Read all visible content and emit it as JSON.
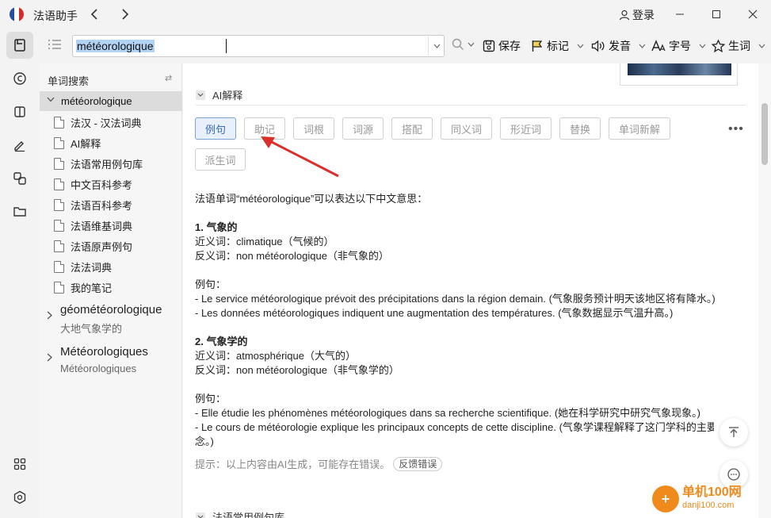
{
  "app": {
    "title": "法语助手",
    "login_label": "登录"
  },
  "search": {
    "value": "météorologique"
  },
  "toolbar": {
    "save": "保存",
    "mark": "标记",
    "pronounce": "发音",
    "font": "字号",
    "vocab": "生词"
  },
  "sidebar": {
    "header": "单词搜索",
    "selected": "météorologique",
    "items": [
      {
        "label": "法汉 - 汉法词典"
      },
      {
        "label": "AI解释"
      },
      {
        "label": "法语常用例句库"
      },
      {
        "label": "中文百科参考"
      },
      {
        "label": "法语百科参考"
      },
      {
        "label": "法语维基词典"
      },
      {
        "label": "法语原声例句"
      },
      {
        "label": "法法词典"
      },
      {
        "label": "我的笔记"
      }
    ],
    "entries": [
      {
        "word": "géométéorologique",
        "meaning": "大地气象学的"
      },
      {
        "word": "Météorologiques",
        "meaning": "Météorologiques"
      }
    ]
  },
  "main": {
    "section_title": "AI解释",
    "tags": [
      "例句",
      "助记",
      "词根",
      "词源",
      "搭配",
      "同义词",
      "形近词",
      "替换",
      "单词新解",
      "派生词"
    ],
    "intro": "法语单词“météorologique”可以表达以下中文意思：",
    "m1_title": "1. 气象的",
    "m1_syn": "近义词：climatique（气候的）",
    "m1_ant": "反义词：non météorologique（非气象的）",
    "ex_label_1": "例句：",
    "m1_ex1": "- Le service météorologique prévoit des précipitations dans la région demain. (气象服务预计明天该地区将有降水。)",
    "m1_ex2": "- Les données météorologiques indiquent une augmentation des températures. (气象数据显示气温升高。)",
    "m2_title": "2. 气象学的",
    "m2_syn": "近义词：atmosphérique（大气的）",
    "m2_ant": "反义词：non météorologique（非气象学的）",
    "ex_label_2": "例句：",
    "m2_ex1": "- Elle étudie les phénomènes météorologiques dans sa recherche scientifique. (她在科学研究中研究气象现象。)",
    "m2_ex2": "- Le cours de météorologie explique les principaux concepts de cette discipline. (气象学课程解释了这门学科的主要概",
    "m2_ex2b": "念。)",
    "hint": "提示：以上内容由AI生成，可能存在错误。",
    "feedback": "反馈错误",
    "section2_title": "法语常用例句库"
  },
  "watermark": {
    "cn": "单机100网",
    "url": "danji100.com"
  },
  "colors": {
    "accent": "#3a6db5",
    "annotation_arrow": "#d9302c",
    "watermark": "#f08a1c"
  }
}
